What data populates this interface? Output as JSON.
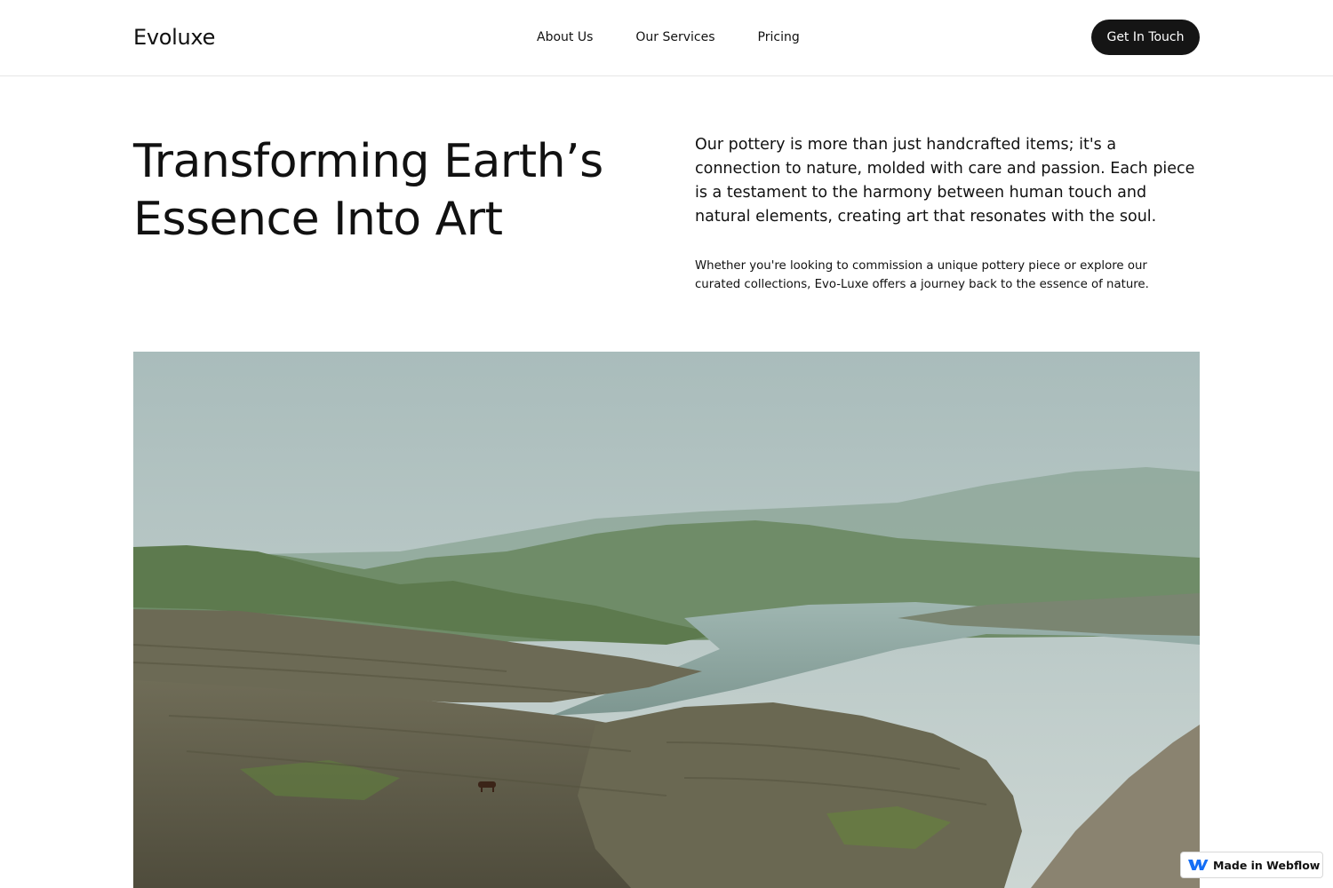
{
  "header": {
    "logo": "Evoluxe",
    "nav": [
      {
        "label": "About Us"
      },
      {
        "label": "Our Services"
      },
      {
        "label": "Pricing"
      }
    ],
    "cta_label": "Get In Touch"
  },
  "hero": {
    "title_line1": "Transforming Earth’s",
    "title_line2": "Essence Into Art",
    "lead": "Our pottery is more than just handcrafted items; it's a connection to nature, molded with care and passion. Each piece is a testament to the harmony between human touch and natural elements, creating art that resonates with the soul.",
    "sub": "Whether you're looking to commission a unique pottery piece or explore our curated collections, Evo-Luxe offers a journey back to the essence of nature."
  },
  "image": {
    "subject": "landscape-photo",
    "palette": {
      "sky": "#b7c6c5",
      "hills_far": "#7f9c8a",
      "hills_mid": "#5f7f58",
      "water": "#8ea8a2",
      "ground": "#6d6a55"
    }
  },
  "badge": {
    "label": "Made in Webflow",
    "icon": "webflow-icon",
    "accent": "#146ef5"
  },
  "colors": {
    "button_bg": "#151515",
    "text": "#111111",
    "divider": "#e6e6e6"
  }
}
